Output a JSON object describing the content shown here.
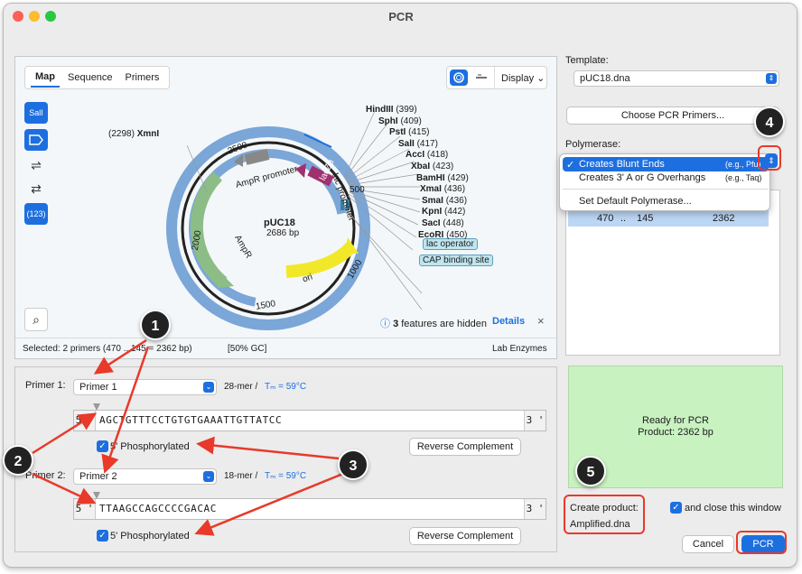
{
  "window": {
    "title": "PCR"
  },
  "map": {
    "tabs": [
      "Map",
      "Sequence",
      "Primers"
    ],
    "display_label": "Display",
    "plasmid_name": "pUC18",
    "plasmid_size": "2686 bp",
    "side_buttons": [
      "SalI",
      "(123)"
    ],
    "features": [
      "AmpR promoter",
      "AmpR",
      "lacZα",
      "lac promoter",
      "ori",
      "lac operator",
      "CAP binding site"
    ],
    "ticks": [
      "2500",
      "500",
      "2000",
      "1000",
      "1500"
    ],
    "sites_left": {
      "pos": "(2298)",
      "name": "XmnI"
    },
    "sites": [
      {
        "name": "HindIII",
        "pos": "(399)"
      },
      {
        "name": "SphI",
        "pos": "(409)"
      },
      {
        "name": "PstI",
        "pos": "(415)"
      },
      {
        "name": "SalI",
        "pos": "(417)"
      },
      {
        "name": "AccI",
        "pos": "(418)"
      },
      {
        "name": "XbaI",
        "pos": "(423)"
      },
      {
        "name": "BamHI",
        "pos": "(429)"
      },
      {
        "name": "XmaI",
        "pos": "(436)"
      },
      {
        "name": "SmaI",
        "pos": "(436)"
      },
      {
        "name": "KpnI",
        "pos": "(442)"
      },
      {
        "name": "SacI",
        "pos": "(448)"
      },
      {
        "name": "EcoRI",
        "pos": "(450)"
      }
    ],
    "hidden_notice": {
      "count": "3",
      "text": "features are hidden",
      "link": "Details"
    },
    "status": {
      "selected": "Selected:  2 primers  (470  ..  145  =  2362 bp)",
      "gc": "[50% GC]",
      "enzymes": "Lab Enzymes"
    }
  },
  "right": {
    "template_label": "Template:",
    "template_value": "pUC18.dna",
    "choose_primers": "Choose PCR Primers...",
    "polymerase_label": "Polymerase:",
    "polymerase_options": [
      {
        "label": "Creates Blunt Ends",
        "example": "(e.g., Pfu)",
        "selected": true,
        "check": "✓"
      },
      {
        "label": "Creates 3' A or G Overhangs",
        "example": "(e.g., Taq)",
        "selected": false
      }
    ],
    "set_default": "Set Default Polymerase...",
    "product_row": {
      "start": "470",
      "sep": "..",
      "end": "145",
      "len": "2362"
    },
    "ready": {
      "line1": "Ready for PCR",
      "line2": "Product:  2362 bp"
    },
    "create_product_label": "Create product:",
    "create_product_value": "Amplified.dna",
    "close_window": "and close this window",
    "cancel": "Cancel",
    "pcr": "PCR"
  },
  "primers": [
    {
      "label": "Primer 1:",
      "select": "Primer 1",
      "mer": "28-mer  /",
      "tm": "Tₘ = 59°C",
      "seq": "AGCTGTTTCCTGTGTGAAATTGTTATCC",
      "five": "5 '",
      "three": "3 '",
      "phos": "5' Phosphorylated",
      "revcomp": "Reverse Complement"
    },
    {
      "label": "Primer 2:",
      "select": "Primer 2",
      "mer": "18-mer  /",
      "tm": "Tₘ = 59°C",
      "seq": "TTAAGCCAGCCCCGACAC",
      "five": "5 '",
      "three": "3 '",
      "phos": "5' Phosphorylated",
      "revcomp": "Reverse Complement"
    }
  ],
  "callouts": [
    "1",
    "2",
    "3",
    "4",
    "5"
  ],
  "colors": {
    "accent": "#1d6fe0",
    "red": "#e8392a",
    "ready_bg": "#c8f2c0",
    "ring": "#6fa0d6"
  }
}
